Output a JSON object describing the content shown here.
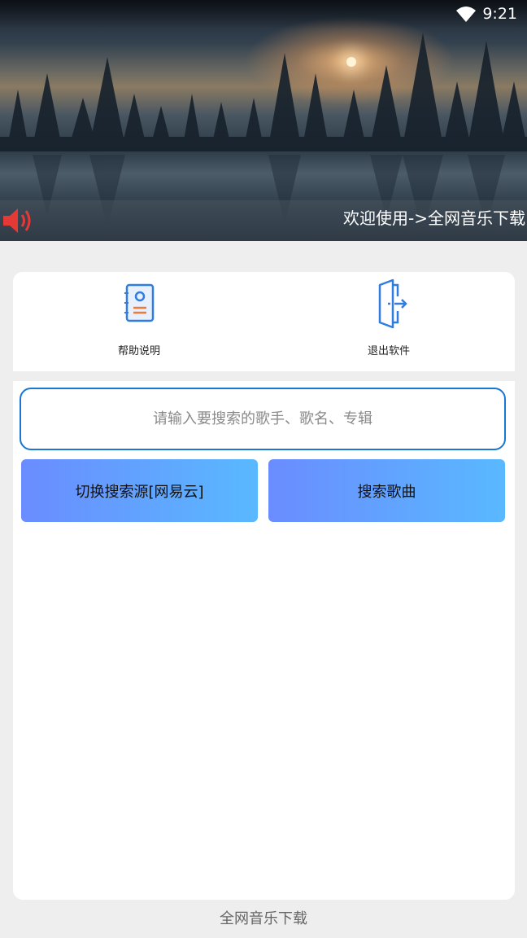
{
  "status_bar": {
    "time": "9:21",
    "wifi_icon": "wifi-icon"
  },
  "banner": {
    "marquee_text": "欢迎使用->全网音乐下载",
    "speaker_icon": "speaker-icon",
    "speaker_color": "#e53935"
  },
  "actions": [
    {
      "label": "帮助说明",
      "icon": "help-document-icon"
    },
    {
      "label": "退出软件",
      "icon": "exit-door-icon"
    }
  ],
  "search": {
    "placeholder": "请输入要搜索的歌手、歌名、专辑",
    "value": ""
  },
  "buttons": {
    "switch_source_label": "切换搜索源[网易云]",
    "search_label": "搜索歌曲"
  },
  "footer": {
    "label": "全网音乐下载"
  },
  "colors": {
    "accent": "#1976d2",
    "button_gradient_start": "#6a8cff",
    "button_gradient_end": "#59b9ff",
    "background": "#eeeeee"
  }
}
